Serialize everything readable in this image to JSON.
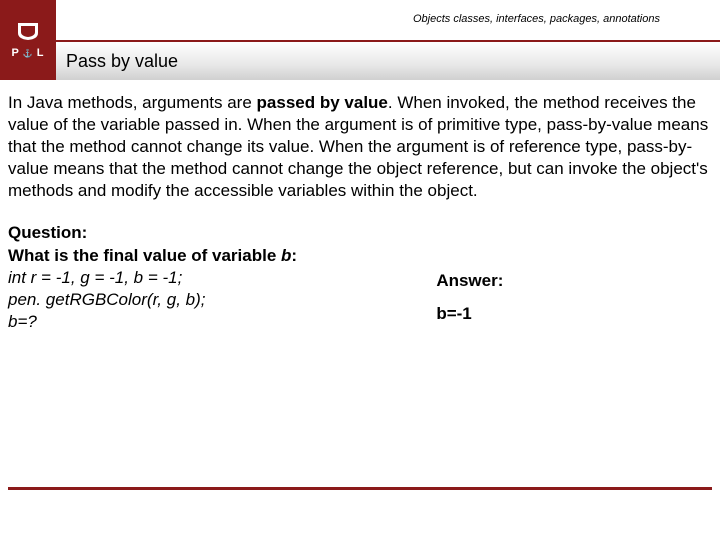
{
  "header": {
    "logo_letters_left": "P",
    "logo_letters_right": "L",
    "breadcrumb": "Objects classes, interfaces, packages, annotations",
    "title": "Pass by value"
  },
  "body": {
    "intro_pre": "In Java methods, arguments are ",
    "intro_bold": "passed by value",
    "intro_post": ". When invoked, the method receives the value of the variable passed in. When the argument is of primitive type, pass-by-value means that the method cannot change its value. When the argument is of reference type, pass-by-value means that the method cannot change the object reference, but can invoke the object's methods and modify the accessible variables within the object.",
    "question_label": "Question:",
    "question_line1_pre": "What is the final value of variable ",
    "question_line1_b": "b",
    "question_line1_post": ":",
    "question_code1": "int r = -1, g = -1, b = -1;",
    "question_code2": "pen. getRGBColor(r, g, b);",
    "question_code3": "b=?",
    "answer_label": "Answer:",
    "answer_value": "b=-1"
  }
}
